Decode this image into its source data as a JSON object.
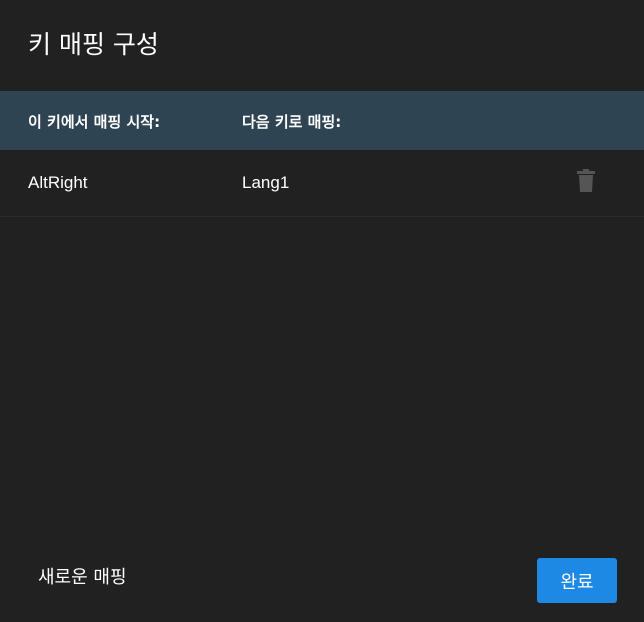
{
  "dialog": {
    "title": "키 매핑 구성"
  },
  "table": {
    "headers": {
      "from": "이 키에서 매핑 시작:",
      "to": "다음 키로 매핑:"
    },
    "rows": [
      {
        "from": "AltRight",
        "to": "Lang1",
        "action_icon": "trash-icon"
      }
    ]
  },
  "footer": {
    "new_mapping_label": "새로운 매핑",
    "done_label": "완료"
  },
  "colors": {
    "background": "#212121",
    "header_background": "#2e4453",
    "accent": "#1e88e5",
    "delete_icon": "#555555"
  }
}
